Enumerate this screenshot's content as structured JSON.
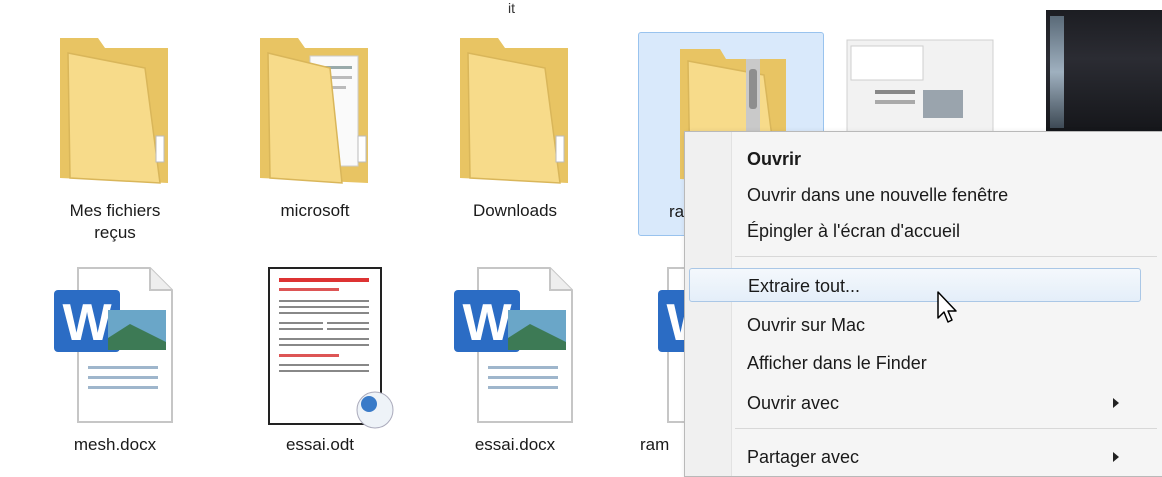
{
  "explorer": {
    "top_clip_label": "it",
    "items": [
      {
        "label": "Mes fichiers\nreçus",
        "icon": "folder-icon"
      },
      {
        "label": "microsoft",
        "icon": "folder-with-papers-icon"
      },
      {
        "label": "Downloads",
        "icon": "folder-icon"
      },
      {
        "label": "ra",
        "icon": "zip-folder-icon"
      },
      {
        "label": "",
        "icon": "document-preview-icon"
      },
      {
        "label": "mesh.docx",
        "icon": "word-document-icon"
      },
      {
        "label": "essai.odt",
        "icon": "odt-document-icon"
      },
      {
        "label": "essai.docx",
        "icon": "word-document-icon"
      },
      {
        "label": "ram",
        "icon": "word-document-icon"
      }
    ]
  },
  "context_menu": {
    "items": [
      {
        "label": "Ouvrir",
        "bold": true
      },
      {
        "label": "Ouvrir dans une nouvelle fenêtre"
      },
      {
        "label": "Épingler à l'écran d'accueil"
      },
      {
        "label": "Extraire tout...",
        "hover": true
      },
      {
        "label": "Ouvrir sur Mac"
      },
      {
        "label": "Afficher dans le Finder"
      },
      {
        "label": "Ouvrir avec",
        "submenu": true
      },
      {
        "label": "Partager avec",
        "submenu": true
      }
    ]
  },
  "colors": {
    "selection_bg": "#d9e9fb",
    "selection_border": "#99c3ee",
    "folder_yellow": "#f2d27a",
    "word_blue": "#2b6cc4"
  }
}
